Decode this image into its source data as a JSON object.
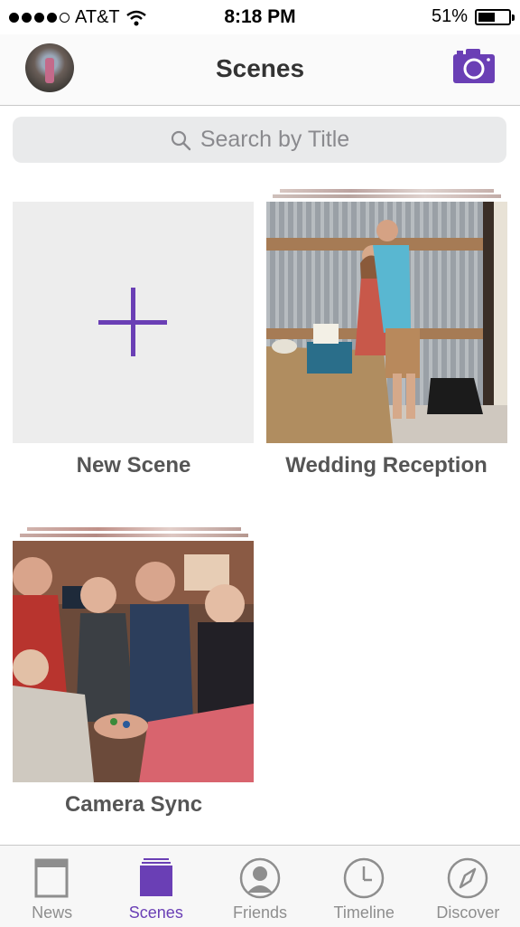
{
  "status_bar": {
    "carrier": "AT&T",
    "time": "8:18 PM",
    "battery": "51%"
  },
  "nav": {
    "title": "Scenes"
  },
  "search": {
    "placeholder": "Search by Title"
  },
  "scenes": [
    {
      "label": "New Scene"
    },
    {
      "label": "Wedding Reception"
    },
    {
      "label": "Camera Sync"
    }
  ],
  "tabs": [
    {
      "label": "News",
      "icon": "news-icon"
    },
    {
      "label": "Scenes",
      "icon": "scenes-icon",
      "active": true
    },
    {
      "label": "Friends",
      "icon": "friends-icon"
    },
    {
      "label": "Timeline",
      "icon": "timeline-icon"
    },
    {
      "label": "Discover",
      "icon": "discover-icon"
    }
  ],
  "colors": {
    "accent": "#6a3fb5",
    "inactive": "#8e8e8e"
  }
}
